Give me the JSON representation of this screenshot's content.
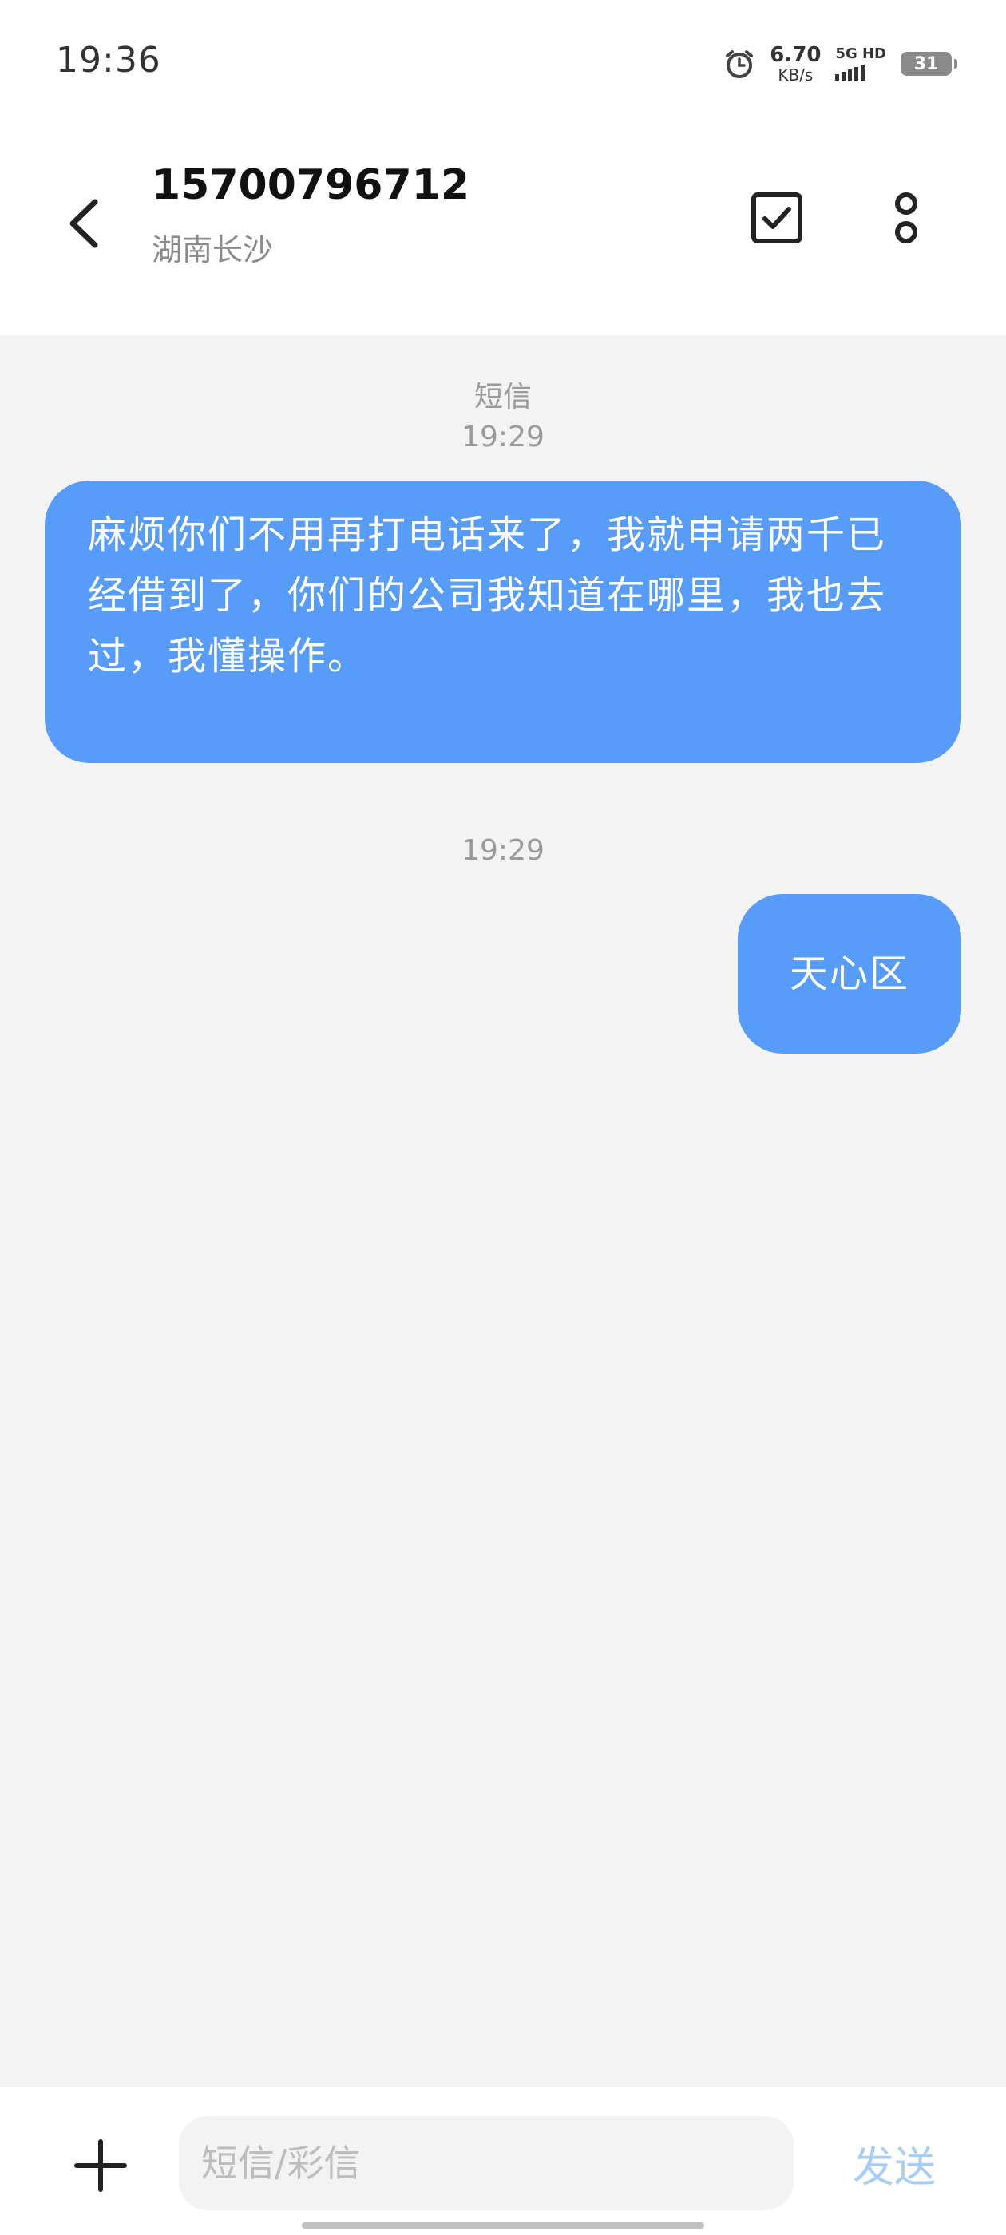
{
  "status_bar": {
    "time": "19:36",
    "net_speed_value": "6.70",
    "net_speed_unit": "KB/s",
    "network_type": "5G HD",
    "battery_level": "31",
    "icons": [
      "alarm-icon",
      "signal-icon",
      "battery-icon"
    ]
  },
  "header": {
    "contact_number": "15700796712",
    "contact_location": "湖南长沙",
    "icons": [
      "back-arrow-icon",
      "select-checkbox-icon",
      "more-options-icon"
    ]
  },
  "conversation": {
    "channel_label": "短信",
    "messages": [
      {
        "time": "19:29",
        "text": "麻烦你们不用再打电话来了，我就申请两千已经借到了，你们的公司我知道在哪里，我也去过，我懂操作。"
      },
      {
        "time": "19:29",
        "text": "天心区"
      }
    ]
  },
  "composer": {
    "placeholder": "短信/彩信",
    "send_label": "发送",
    "icons": [
      "add-icon"
    ]
  },
  "colors": {
    "bubble": "#579cf8",
    "background": "#f3f3f3",
    "send_disabled": "#a6cdf7"
  }
}
